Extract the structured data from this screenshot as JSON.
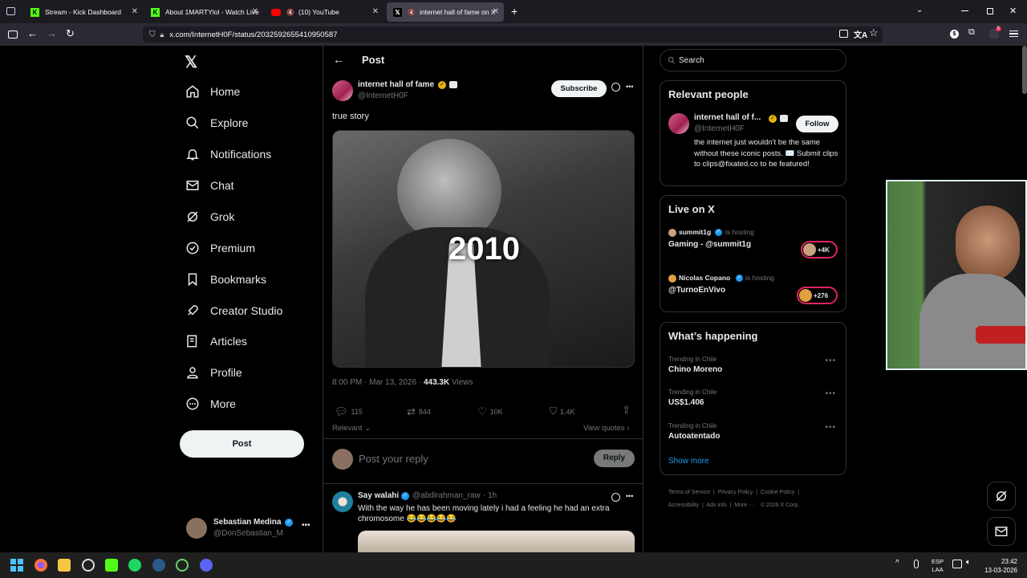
{
  "browser": {
    "tabs": [
      {
        "label": "Stream - Kick Dashboard"
      },
      {
        "label": "About 1MARTYlol - Watch Live"
      },
      {
        "label": "(10) YouTube"
      },
      {
        "label": "internet hall of fame on X:"
      }
    ],
    "url": "x.com/InternetH0F/status/2032592655410950587"
  },
  "sidebar": {
    "items": [
      {
        "label": "Home"
      },
      {
        "label": "Explore"
      },
      {
        "label": "Notifications"
      },
      {
        "label": "Chat"
      },
      {
        "label": "Grok"
      },
      {
        "label": "Premium"
      },
      {
        "label": "Bookmarks"
      },
      {
        "label": "Creator Studio"
      },
      {
        "label": "Articles"
      },
      {
        "label": "Profile"
      },
      {
        "label": "More"
      }
    ],
    "post_label": "Post",
    "user": {
      "name": "Sebastian Medina",
      "handle": "@DonSebastian_M"
    }
  },
  "post": {
    "header_title": "Post",
    "author_name": "internet hall of fame",
    "author_handle": "@InternetH0F",
    "subscribe_label": "Subscribe",
    "text": "true story",
    "media_overlay": "2010",
    "time": "8:00 PM · Mar 13, 2026 · ",
    "views_count": "443.3K",
    "views_label": " Views",
    "stats": {
      "replies": "115",
      "reposts": "844",
      "likes": "10K",
      "bookmarks": "1.4K"
    },
    "sort_label": "Relevant",
    "view_quotes": "View quotes",
    "reply_placeholder": "Post your reply",
    "reply_button": "Reply"
  },
  "reply": {
    "name": "Say walahi",
    "handle": "@abdirahman_raw",
    "time": "· 1h",
    "text": "With the way he has been moving lately i had a feeling he had an extra chromosome 😂😂😂😂😂"
  },
  "right": {
    "search_placeholder": "Search",
    "relevant_title": "Relevant people",
    "person": {
      "name": "internet hall of f...",
      "handle": "@InternetH0F",
      "follow": "Follow",
      "bio": "the internet just wouldn't be the same without these iconic posts. ✉️ Submit clips to clips@fixated.co to be featured!"
    },
    "live_title": "Live on X",
    "live": [
      {
        "host": "summit1g",
        "hosting": "is hosting",
        "title": "Gaming - @summit1g",
        "count": "+4K"
      },
      {
        "host": "Nicolas Copano",
        "hosting": "is hosting",
        "title": "@TurnoEnVivo",
        "count": "+276"
      }
    ],
    "happening_title": "What’s happening",
    "trends": [
      {
        "context": "Trending in Chile",
        "topic": "Chino Moreno"
      },
      {
        "context": "Trending in Chile",
        "topic": "US$1.406"
      },
      {
        "context": "Trending in Chile",
        "topic": "Autoatentado"
      }
    ],
    "show_more": "Show more",
    "footer": [
      "Terms of Service",
      "Privacy Policy",
      "Cookie Policy",
      "Accessibility",
      "Ads info",
      "More ···",
      "© 2026 X Corp."
    ]
  },
  "taskbar": {
    "lang": "ESP",
    "lang2": "LAA",
    "time": "23:42",
    "date": "13-03-2026"
  }
}
